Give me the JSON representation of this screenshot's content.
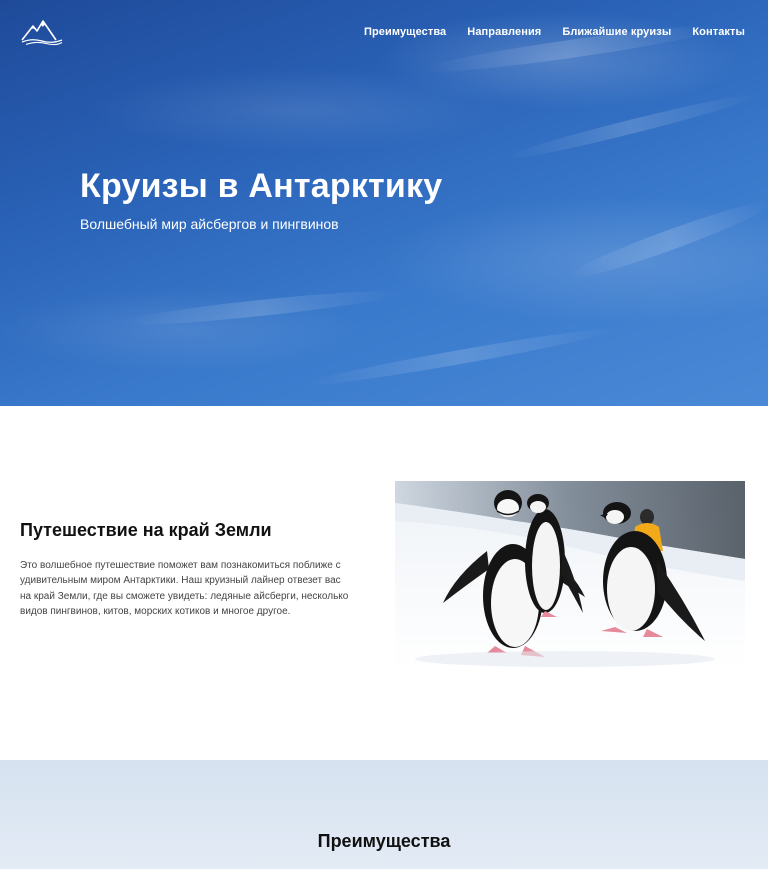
{
  "header": {
    "logo_icon": "mountain-logo-icon",
    "nav": [
      {
        "label": "Преимущества"
      },
      {
        "label": "Направления"
      },
      {
        "label": "Ближайшие круизы"
      },
      {
        "label": "Контакты"
      }
    ]
  },
  "hero": {
    "title": "Круизы в Антарктику",
    "subtitle": "Волшебный мир айсбергов и пингвинов"
  },
  "about": {
    "title": "Путешествие на край Земли",
    "text": "Это волшебное путешествие поможет вам познакомиться поближе с удивительным миром Антарктики. Наш круизный лайнер отвезет вас на край Земли, где вы сможете увидеть: ледяные айсберги, несколько видов пингвинов, китов, морских котиков и многое другое.",
    "image": "penguins-photo"
  },
  "advantages": {
    "title": "Преимущества"
  },
  "colors": {
    "hero_blue": "#2a63b8",
    "advantages_bg": "#dce6f2",
    "text_dark": "#111111"
  }
}
